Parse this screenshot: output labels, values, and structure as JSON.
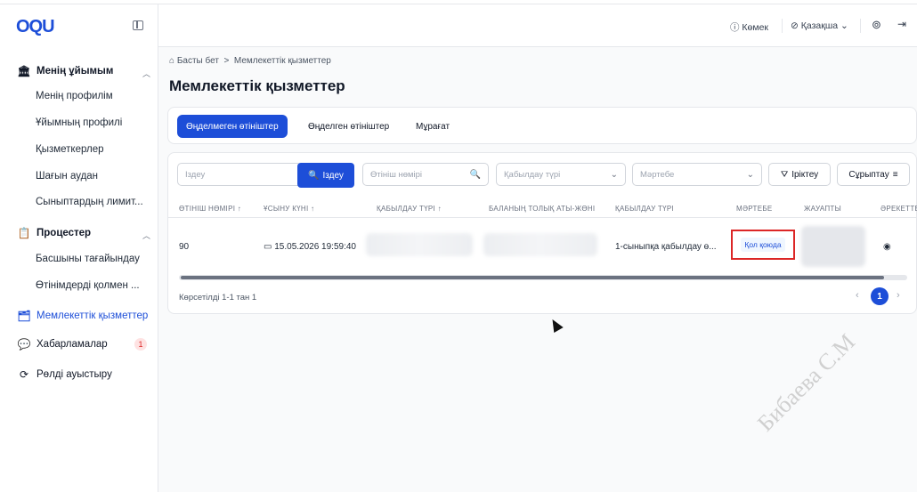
{
  "app": {
    "logo": "OQU"
  },
  "sidebar": {
    "groups": [
      {
        "label": "Менің ұйымым",
        "items": [
          "Менің профилім",
          "Ұйымның профилі",
          "Қызметкерлер",
          "Шағын аудан",
          "Сыныптардың лимит..."
        ]
      },
      {
        "label": "Процестер",
        "items": [
          "Басшыны тағайындау",
          "Өтінімдерді қолмен ..."
        ]
      }
    ],
    "links": [
      {
        "label": "Мемлекеттік қызметтер",
        "active": true
      },
      {
        "label": "Хабарламалар",
        "badge": "1"
      },
      {
        "label": "Рөлді ауыстыру"
      }
    ]
  },
  "header": {
    "help": "Көмек",
    "language": "Қазақша"
  },
  "breadcrumb": {
    "home": "Басты бет",
    "separator": ">",
    "current": "Мемлекеттік қызметтер"
  },
  "page": {
    "title": "Мемлекеттік қызметтер"
  },
  "tabs": [
    {
      "label": "Өңделмеген өтініштер",
      "active": true
    },
    {
      "label": "Өңделген өтініштер"
    },
    {
      "label": "Мұрағат"
    }
  ],
  "filters": {
    "search_placeholder": "Іздеу",
    "search_button": "Іздеу",
    "app_number_placeholder": "Өтініш нөмірі",
    "admission_type_placeholder": "Қабылдау түрі",
    "status_placeholder": "Мәртебе",
    "filter_button": "Іріктеу",
    "sort_button": "Сұрыптау"
  },
  "table": {
    "columns": [
      "ӨТІНІШ НӨМІРІ ↑",
      "ҰСЫНУ КҮНІ ↑",
      "ҚАБЫЛДАУ ТҮРІ ↑",
      "БАЛАНЫҢ ТОЛЫҚ АТЫ-ЖӨНІ",
      "ҚАБЫЛДАУ ТҮРІ",
      "МӘРТЕБЕ",
      "ЖАУАПТЫ",
      "ӘРЕКЕТТЕ"
    ],
    "rows": [
      {
        "number": "90",
        "date": "15.05.2026 19:59:40",
        "admission": "1-сыныпқа қабылдау ө...",
        "status": "Қол қоюда"
      }
    ]
  },
  "footer": {
    "shown": "Көрсетілді 1-1 тан 1",
    "page": "1"
  },
  "watermark": "Бибаева С.М",
  "colors": {
    "primary": "#1d4ed8",
    "highlight": "#dc2626"
  }
}
